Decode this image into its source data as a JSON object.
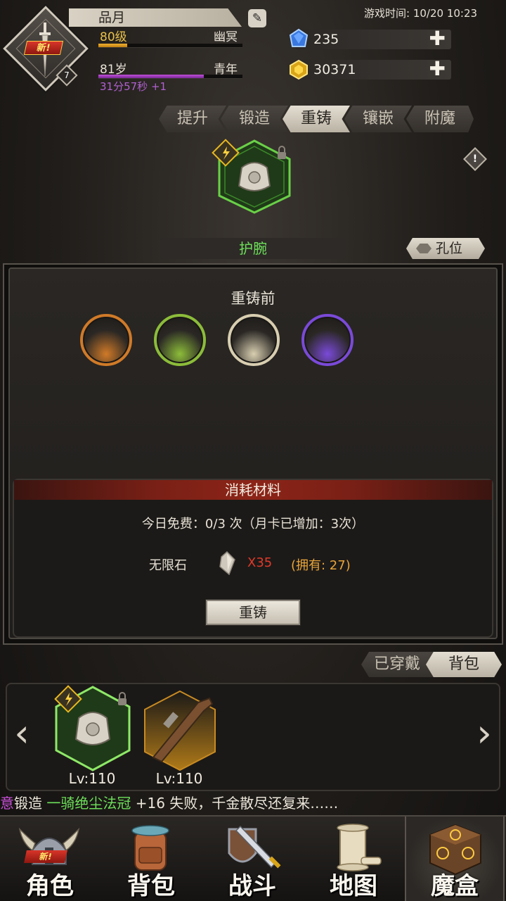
{
  "header": {
    "new_badge": "新!",
    "avatar_level": "7",
    "player_name": "品月",
    "level": "80级",
    "realm": "幽冥",
    "age": "81岁",
    "age_stage": "青年",
    "timer": "31分57秒 +1",
    "game_time": "游戏时间: 10/20 10:23",
    "level_progress": 0.2,
    "age_progress": 0.73
  },
  "resources": [
    {
      "name": "blue-gem",
      "value": "235",
      "color": "#3a78e0"
    },
    {
      "name": "gold-gem",
      "value": "30371",
      "color": "#e8b820"
    }
  ],
  "tabs": [
    "提升",
    "锻造",
    "重铸",
    "镶嵌",
    "附魔"
  ],
  "active_tab": 2,
  "item": {
    "name": "护腕",
    "slot_label": "孔位"
  },
  "recast": {
    "before_title": "重铸前",
    "orbs": [
      {
        "color": "#d07a28"
      },
      {
        "color": "#8cbc3a"
      },
      {
        "color": "#d8ceb0"
      },
      {
        "color": "#7a4ad8"
      }
    ],
    "material_title": "消耗材料",
    "free_line": "今日免费：0/3 次（月卡已增加：3次）",
    "material_name": "无限石",
    "material_cost": "X35",
    "material_owned": "(拥有: 27)",
    "button_label": "重铸"
  },
  "toggle": {
    "equipped": "已穿戴",
    "bag": "背包"
  },
  "strip_items": [
    {
      "level": "Lv:110",
      "frame_color": "#6ad048"
    },
    {
      "level": "Lv:110",
      "frame_color": "#c88a22"
    }
  ],
  "ticker": {
    "prefix": "意",
    "action": "锻造",
    "item": "一骑绝尘法冠",
    "result": "+16 失败，千金散尽还复来……"
  },
  "nav": [
    {
      "label": "角色",
      "icon": "helmet-icon",
      "new_badge": "新!"
    },
    {
      "label": "背包",
      "icon": "backpack-icon"
    },
    {
      "label": "战斗",
      "icon": "sword-shield-icon"
    },
    {
      "label": "地图",
      "icon": "scroll-map-icon"
    },
    {
      "label": "魔盒",
      "icon": "magic-box-icon"
    }
  ],
  "active_nav": 4
}
